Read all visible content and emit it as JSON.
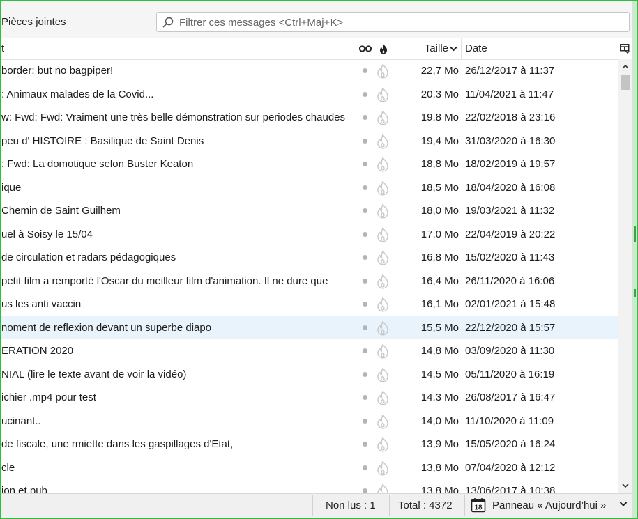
{
  "toolbar": {
    "attachments_label": "Pièces jointes",
    "filter_placeholder": "Filtrer ces messages <Ctrl+Maj+K>"
  },
  "columns": {
    "subject_label": "t",
    "read_icon": "glasses-icon",
    "junk_icon": "flame-icon",
    "size_label": "Taille",
    "date_label": "Date",
    "picker_icon": "column-picker-icon"
  },
  "messages": [
    {
      "subject": " border: but no bagpiper!",
      "size": "22,7 Mo",
      "date": "26/12/2017 à 11:37",
      "highlighted": false
    },
    {
      "subject": ": Animaux malades de la Covid...",
      "size": "20,3 Mo",
      "date": "11/04/2021 à 11:47",
      "highlighted": false
    },
    {
      "subject": "w: Fwd: Fwd: Vraiment une très belle démonstration sur periodes chaudes",
      "size": "19,8 Mo",
      "date": "22/02/2018 à 23:16",
      "highlighted": false
    },
    {
      "subject": " peu d' HISTOIRE : Basilique de Saint Denis",
      "size": "19,4 Mo",
      "date": "31/03/2020 à 16:30",
      "highlighted": false
    },
    {
      "subject": ": Fwd: La domotique selon Buster Keaton",
      "size": "18,8 Mo",
      "date": "18/02/2019 à 19:57",
      "highlighted": false
    },
    {
      "subject": "ique",
      "size": "18,5 Mo",
      "date": "18/04/2020 à 16:08",
      "highlighted": false
    },
    {
      "subject": " Chemin de Saint Guilhem",
      "size": "18,0 Mo",
      "date": "19/03/2021 à 11:32",
      "highlighted": false
    },
    {
      "subject": "uel à Soisy le 15/04",
      "size": "17,0 Mo",
      "date": "22/04/2019 à 20:22",
      "highlighted": false
    },
    {
      "subject": " de circulation et radars pédagogiques",
      "size": "16,8 Mo",
      "date": "15/02/2020 à 11:43",
      "highlighted": false
    },
    {
      "subject": "petit film a remporté l'Oscar du meilleur film d'animation. Il ne dure que",
      "size": "16,4 Mo",
      "date": "26/11/2020 à 16:06",
      "highlighted": false
    },
    {
      "subject": "us les anti vaccin",
      "size": "16,1 Mo",
      "date": "02/01/2021 à 15:48",
      "highlighted": false
    },
    {
      "subject": "noment de reflexion devant un superbe diapo",
      "size": "15,5 Mo",
      "date": "22/12/2020 à 15:57",
      "highlighted": true
    },
    {
      "subject": "ERATION 2020",
      "size": "14,8 Mo",
      "date": "03/09/2020 à 11:30",
      "highlighted": false
    },
    {
      "subject": "NIAL (lire le texte avant de voir la vidéo)",
      "size": "14,5 Mo",
      "date": "05/11/2020 à 16:19",
      "highlighted": false
    },
    {
      "subject": "ichier .mp4 pour test",
      "size": "14,3 Mo",
      "date": "26/08/2017 à 16:47",
      "highlighted": false
    },
    {
      "subject": "ucinant..",
      "size": "14,0 Mo",
      "date": "11/10/2020 à 11:09",
      "highlighted": false
    },
    {
      "subject": " de fiscale, une rmiette dans les gaspillages d'Etat,",
      "size": "13,9 Mo",
      "date": "15/05/2020 à 16:24",
      "highlighted": false
    },
    {
      "subject": "cle",
      "size": "13,8 Mo",
      "date": "07/04/2020 à 12:12",
      "highlighted": false
    },
    {
      "subject": "ion et pub",
      "size": "13,8 Mo",
      "date": "13/06/2017 à 10:38",
      "highlighted": false
    }
  ],
  "status": {
    "unread": "Non lus : 1",
    "total": "Total : 4372",
    "today_pane": "Panneau « Aujourd’hui »",
    "calendar_day": "18"
  },
  "colors": {
    "frame": "#2fbf3a",
    "highlight_row": "#e8f3fc"
  }
}
